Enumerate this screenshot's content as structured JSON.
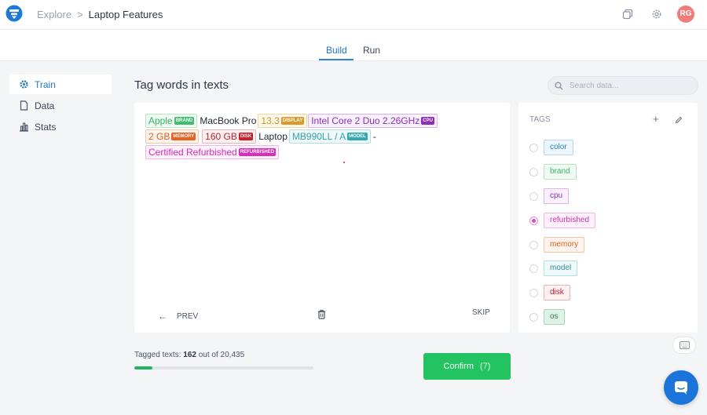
{
  "header": {
    "breadcrumb_root": "Explore",
    "breadcrumb_sep": ">",
    "breadcrumb_current": "Laptop Features",
    "avatar_initials": "RG",
    "icons": [
      "copy-icon",
      "gear-icon"
    ]
  },
  "tabs": [
    {
      "label": "Build",
      "active": true
    },
    {
      "label": "Run",
      "active": false
    }
  ],
  "sidebar": {
    "items": [
      {
        "label": "Train",
        "icon": "gear-icon",
        "active": true
      },
      {
        "label": "Data",
        "icon": "file-icon",
        "active": false
      },
      {
        "label": "Stats",
        "icon": "bar-chart-icon",
        "active": false
      }
    ]
  },
  "main": {
    "title": "Tag words in texts",
    "search_placeholder": "Search data..."
  },
  "text": {
    "tokens": [
      {
        "text": "Apple",
        "tag": "BRAND"
      },
      {
        "text": "MacBook  Pro"
      },
      {
        "text": "13.3",
        "tag": "DISPLAY"
      },
      {
        "text": "Intel Core 2 Duo 2.26GHz",
        "tag": "CPU"
      },
      {
        "text": "2 GB",
        "tag": "MEMORY"
      },
      {
        "text": "160 GB",
        "tag": "DISK"
      },
      {
        "text": "Laptop"
      },
      {
        "text": "MB990LL / A",
        "tag": "MODEL"
      },
      {
        "text": "-"
      },
      {
        "text": "Certified Refurbished",
        "tag": "REFURBISHED"
      }
    ]
  },
  "controls": {
    "prev_label": "PREV",
    "skip_label": "SKIP"
  },
  "tags_panel": {
    "header": "TAGS",
    "add_label": "+",
    "items": [
      {
        "label": "color",
        "selected": false
      },
      {
        "label": "brand",
        "selected": false
      },
      {
        "label": "cpu",
        "selected": false
      },
      {
        "label": "refurbished",
        "selected": true
      },
      {
        "label": "memory",
        "selected": false
      },
      {
        "label": "model",
        "selected": false
      },
      {
        "label": "disk",
        "selected": false
      },
      {
        "label": "os",
        "selected": false
      }
    ]
  },
  "progress": {
    "label": "Tagged texts:",
    "tagged": "162",
    "out_of": "out of",
    "total": "20,435",
    "fill_fraction": 0.1
  },
  "confirm": {
    "label": "Confirm",
    "count": "(7)"
  },
  "colors": {
    "accent": "#2375c2",
    "confirm": "#22c360",
    "brand": "#3fbf6e",
    "display": "#d99a2b",
    "cpu": "#8e2db8",
    "memory": "#e9621f",
    "disk": "#c8202d",
    "model": "#35a7b1",
    "refurbished": "#d62fb9",
    "color_tag": "#3e8ed8",
    "os": "#3a9a5c"
  }
}
